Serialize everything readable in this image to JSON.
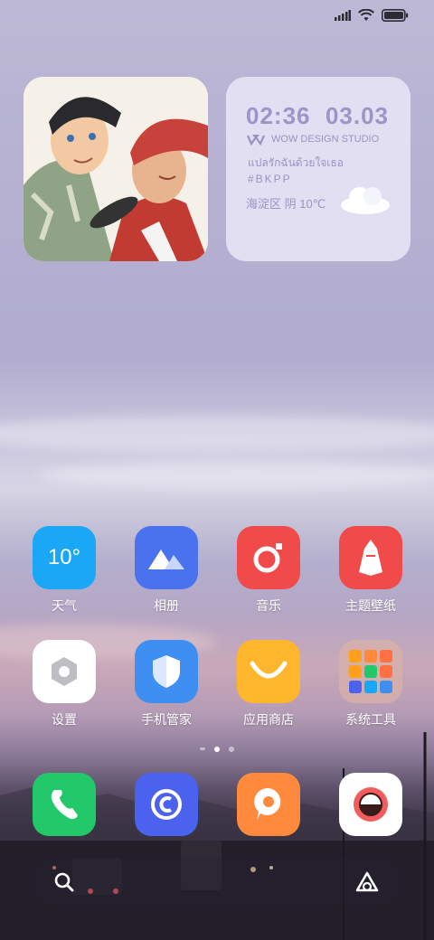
{
  "status": {
    "icons": [
      "signal-icon",
      "wifi-icon",
      "battery-icon"
    ]
  },
  "widget": {
    "time": "02:36",
    "date": "03.03",
    "studio": "WOW DESIGN STUDIO",
    "thai_text": "แปลรักฉันด้วยใจเธอ",
    "tag": "#BKPP",
    "weather": "海淀区 阴 10℃",
    "weather_icon": "cloud-icon"
  },
  "apps": [
    {
      "label": "天气",
      "icon_text": "10°",
      "icon": "weather-icon",
      "color": "#1aa7f6"
    },
    {
      "label": "相册",
      "icon": "gallery-icon",
      "color": "#4a72ee"
    },
    {
      "label": "音乐",
      "icon": "music-icon",
      "color": "#f04a4a"
    },
    {
      "label": "主题壁纸",
      "icon": "themes-icon",
      "color": "#f04a4a"
    },
    {
      "label": "设置",
      "icon": "settings-icon",
      "color": "#ffffff"
    },
    {
      "label": "手机管家",
      "icon": "security-icon",
      "color": "#3f8ff2"
    },
    {
      "label": "应用商店",
      "icon": "app-store-icon",
      "color": "#ffb52c"
    },
    {
      "label": "系统工具",
      "icon": "folder-icon",
      "color": "#d9b2a8"
    }
  ],
  "dock": [
    {
      "name": "phone",
      "icon": "phone-icon",
      "color": "#23c86a"
    },
    {
      "name": "browser",
      "icon": "browser-icon",
      "color": "#4a62ee"
    },
    {
      "name": "messages",
      "icon": "messages-icon",
      "color": "#ff8a3d"
    },
    {
      "name": "camera",
      "icon": "camera-icon",
      "color": "#ffffff"
    }
  ],
  "pages": {
    "count": 2,
    "current": 1
  },
  "search": {
    "icons": [
      "search-icon",
      "assistant-icon"
    ]
  }
}
